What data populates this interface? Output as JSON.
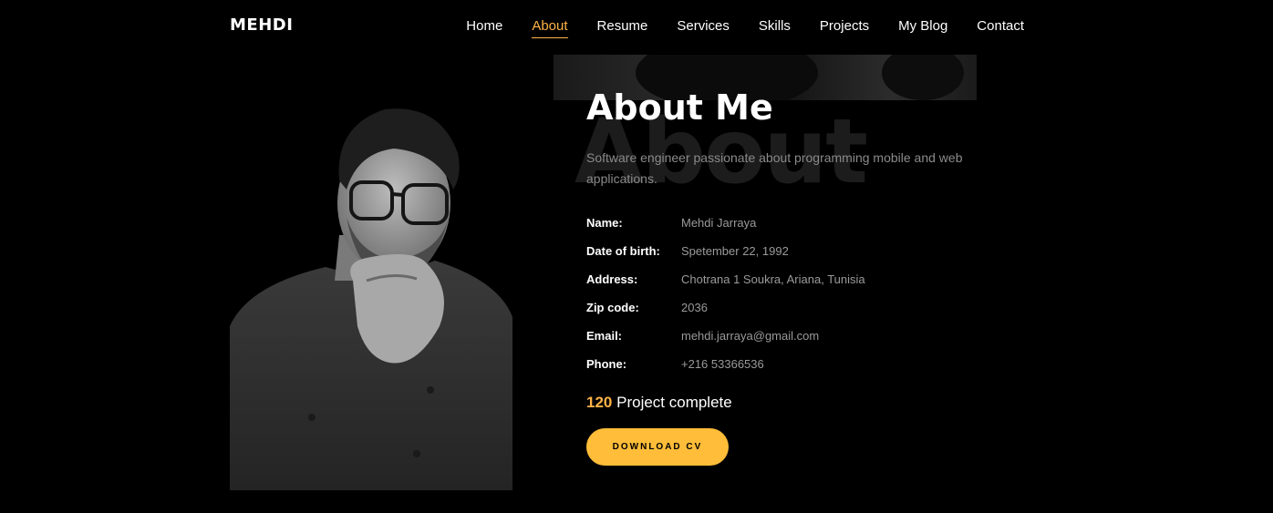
{
  "brand": "MEHDI",
  "nav": {
    "items": [
      "Home",
      "About",
      "Resume",
      "Services",
      "Skills",
      "Projects",
      "My Blog",
      "Contact"
    ],
    "active": "About"
  },
  "about": {
    "bg_word": "About",
    "title": "About Me",
    "description": "Software engineer passionate about programming mobile and web applications.",
    "info": [
      {
        "label": "Name:",
        "value": "Mehdi Jarraya"
      },
      {
        "label": "Date of birth:",
        "value": "Spetember 22, 1992"
      },
      {
        "label": "Address:",
        "value": "Chotrana 1 Soukra, Ariana, Tunisia"
      },
      {
        "label": "Zip code:",
        "value": "2036"
      },
      {
        "label": "Email:",
        "value": "mehdi.jarraya@gmail.com"
      },
      {
        "label": "Phone:",
        "value": "+216 53366536"
      }
    ],
    "projects_count": "120",
    "projects_label": "Project complete",
    "cv_button": "DOWNLOAD CV"
  },
  "colors": {
    "accent": "#ffb347",
    "button": "#ffbd39",
    "background": "#000000"
  }
}
